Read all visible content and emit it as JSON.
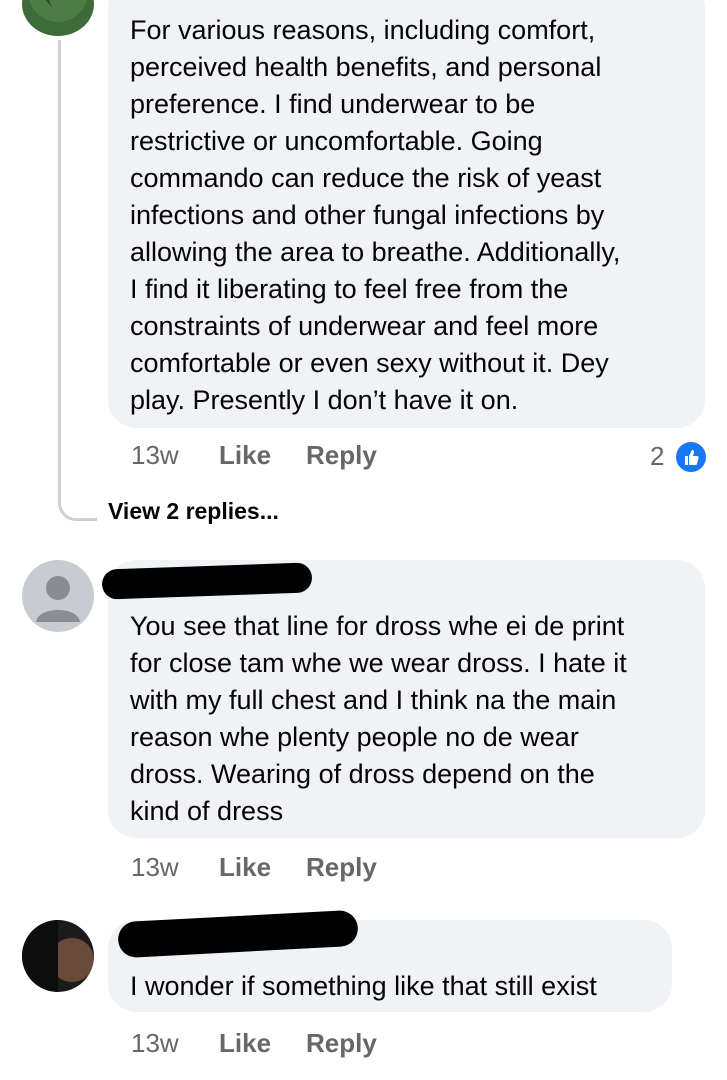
{
  "comments": [
    {
      "text": "For various reasons, including comfort,\nperceived health benefits, and personal\npreference. I find underwear to be\nrestrictive or uncomfortable. Going\ncommando can reduce the risk of yeast\ninfections and other fungal infections by\nallowing the area to breathe. Additionally,\nI find it liberating to feel free from the\nconstraints of underwear and feel more\ncomfortable or even sexy without it. Dey\nplay. Presently I don’t have it on.",
      "time": "13w",
      "like": "Like",
      "reply": "Reply",
      "reaction_count": "2",
      "view_replies": "View 2 replies..."
    },
    {
      "text": "You see that line for dross whe ei de print\nfor close tam whe we wear dross. I hate it\nwith my full chest and I think na the main\nreason whe plenty people no de wear\ndross. Wearing of dross depend on the\nkind of dress",
      "time": "13w",
      "like": "Like",
      "reply": "Reply"
    },
    {
      "text": "I wonder if something like that still exist",
      "time": "13w",
      "like": "Like",
      "reply": "Reply"
    }
  ],
  "colors": {
    "bubble": "#f0f2f5",
    "meta": "#65676b",
    "like_badge": "#1877f2"
  }
}
